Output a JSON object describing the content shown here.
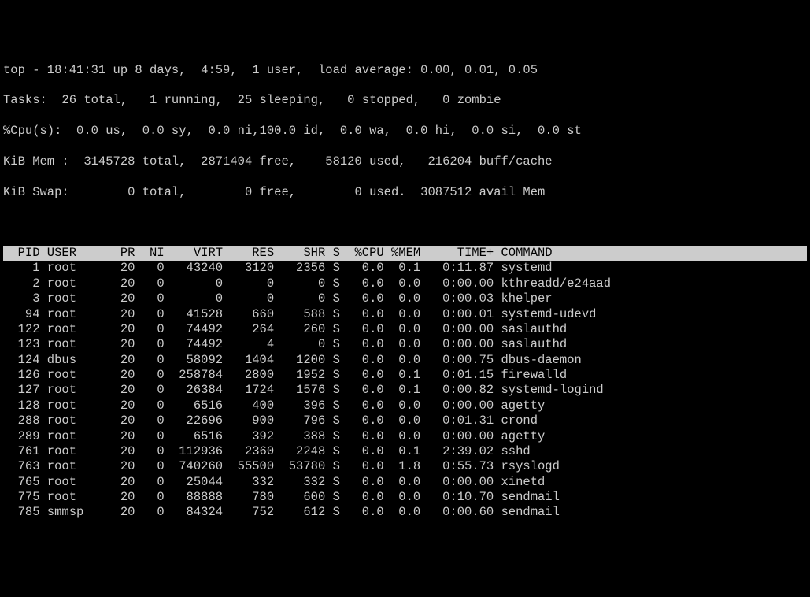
{
  "summary": {
    "line0": "top - 18:41:31 up 8 days,  4:59,  1 user,  load average: 0.00, 0.01, 0.05",
    "line1": "Tasks:  26 total,   1 running,  25 sleeping,   0 stopped,   0 zombie",
    "line2": "%Cpu(s):  0.0 us,  0.0 sy,  0.0 ni,100.0 id,  0.0 wa,  0.0 hi,  0.0 si,  0.0 st",
    "line3": "KiB Mem :  3145728 total,  2871404 free,    58120 used,   216204 buff/cache",
    "line4": "KiB Swap:        0 total,        0 free,        0 used.  3087512 avail Mem"
  },
  "columns": "  PID USER      PR  NI    VIRT    RES    SHR S  %CPU %MEM     TIME+ COMMAND         ",
  "processes": [
    {
      "pid": "1",
      "user": "root",
      "pr": "20",
      "ni": "0",
      "virt": "43240",
      "res": "3120",
      "shr": "2356",
      "s": "S",
      "cpu": "0.0",
      "mem": "0.1",
      "time": "0:11.87",
      "cmd": "systemd"
    },
    {
      "pid": "2",
      "user": "root",
      "pr": "20",
      "ni": "0",
      "virt": "0",
      "res": "0",
      "shr": "0",
      "s": "S",
      "cpu": "0.0",
      "mem": "0.0",
      "time": "0:00.00",
      "cmd": "kthreadd/e24aad"
    },
    {
      "pid": "3",
      "user": "root",
      "pr": "20",
      "ni": "0",
      "virt": "0",
      "res": "0",
      "shr": "0",
      "s": "S",
      "cpu": "0.0",
      "mem": "0.0",
      "time": "0:00.03",
      "cmd": "khelper"
    },
    {
      "pid": "94",
      "user": "root",
      "pr": "20",
      "ni": "0",
      "virt": "41528",
      "res": "660",
      "shr": "588",
      "s": "S",
      "cpu": "0.0",
      "mem": "0.0",
      "time": "0:00.01",
      "cmd": "systemd-udevd"
    },
    {
      "pid": "122",
      "user": "root",
      "pr": "20",
      "ni": "0",
      "virt": "74492",
      "res": "264",
      "shr": "260",
      "s": "S",
      "cpu": "0.0",
      "mem": "0.0",
      "time": "0:00.00",
      "cmd": "saslauthd"
    },
    {
      "pid": "123",
      "user": "root",
      "pr": "20",
      "ni": "0",
      "virt": "74492",
      "res": "4",
      "shr": "0",
      "s": "S",
      "cpu": "0.0",
      "mem": "0.0",
      "time": "0:00.00",
      "cmd": "saslauthd"
    },
    {
      "pid": "124",
      "user": "dbus",
      "pr": "20",
      "ni": "0",
      "virt": "58092",
      "res": "1404",
      "shr": "1200",
      "s": "S",
      "cpu": "0.0",
      "mem": "0.0",
      "time": "0:00.75",
      "cmd": "dbus-daemon"
    },
    {
      "pid": "126",
      "user": "root",
      "pr": "20",
      "ni": "0",
      "virt": "258784",
      "res": "2800",
      "shr": "1952",
      "s": "S",
      "cpu": "0.0",
      "mem": "0.1",
      "time": "0:01.15",
      "cmd": "firewalld"
    },
    {
      "pid": "127",
      "user": "root",
      "pr": "20",
      "ni": "0",
      "virt": "26384",
      "res": "1724",
      "shr": "1576",
      "s": "S",
      "cpu": "0.0",
      "mem": "0.1",
      "time": "0:00.82",
      "cmd": "systemd-logind"
    },
    {
      "pid": "128",
      "user": "root",
      "pr": "20",
      "ni": "0",
      "virt": "6516",
      "res": "400",
      "shr": "396",
      "s": "S",
      "cpu": "0.0",
      "mem": "0.0",
      "time": "0:00.00",
      "cmd": "agetty"
    },
    {
      "pid": "288",
      "user": "root",
      "pr": "20",
      "ni": "0",
      "virt": "22696",
      "res": "900",
      "shr": "796",
      "s": "S",
      "cpu": "0.0",
      "mem": "0.0",
      "time": "0:01.31",
      "cmd": "crond"
    },
    {
      "pid": "289",
      "user": "root",
      "pr": "20",
      "ni": "0",
      "virt": "6516",
      "res": "392",
      "shr": "388",
      "s": "S",
      "cpu": "0.0",
      "mem": "0.0",
      "time": "0:00.00",
      "cmd": "agetty"
    },
    {
      "pid": "761",
      "user": "root",
      "pr": "20",
      "ni": "0",
      "virt": "112936",
      "res": "2360",
      "shr": "2248",
      "s": "S",
      "cpu": "0.0",
      "mem": "0.1",
      "time": "2:39.02",
      "cmd": "sshd"
    },
    {
      "pid": "763",
      "user": "root",
      "pr": "20",
      "ni": "0",
      "virt": "740260",
      "res": "55500",
      "shr": "53780",
      "s": "S",
      "cpu": "0.0",
      "mem": "1.8",
      "time": "0:55.73",
      "cmd": "rsyslogd"
    },
    {
      "pid": "765",
      "user": "root",
      "pr": "20",
      "ni": "0",
      "virt": "25044",
      "res": "332",
      "shr": "332",
      "s": "S",
      "cpu": "0.0",
      "mem": "0.0",
      "time": "0:00.00",
      "cmd": "xinetd"
    },
    {
      "pid": "775",
      "user": "root",
      "pr": "20",
      "ni": "0",
      "virt": "88888",
      "res": "780",
      "shr": "600",
      "s": "S",
      "cpu": "0.0",
      "mem": "0.0",
      "time": "0:10.70",
      "cmd": "sendmail"
    },
    {
      "pid": "785",
      "user": "smmsp",
      "pr": "20",
      "ni": "0",
      "virt": "84324",
      "res": "752",
      "shr": "612",
      "s": "S",
      "cpu": "0.0",
      "mem": "0.0",
      "time": "0:00.60",
      "cmd": "sendmail"
    }
  ]
}
